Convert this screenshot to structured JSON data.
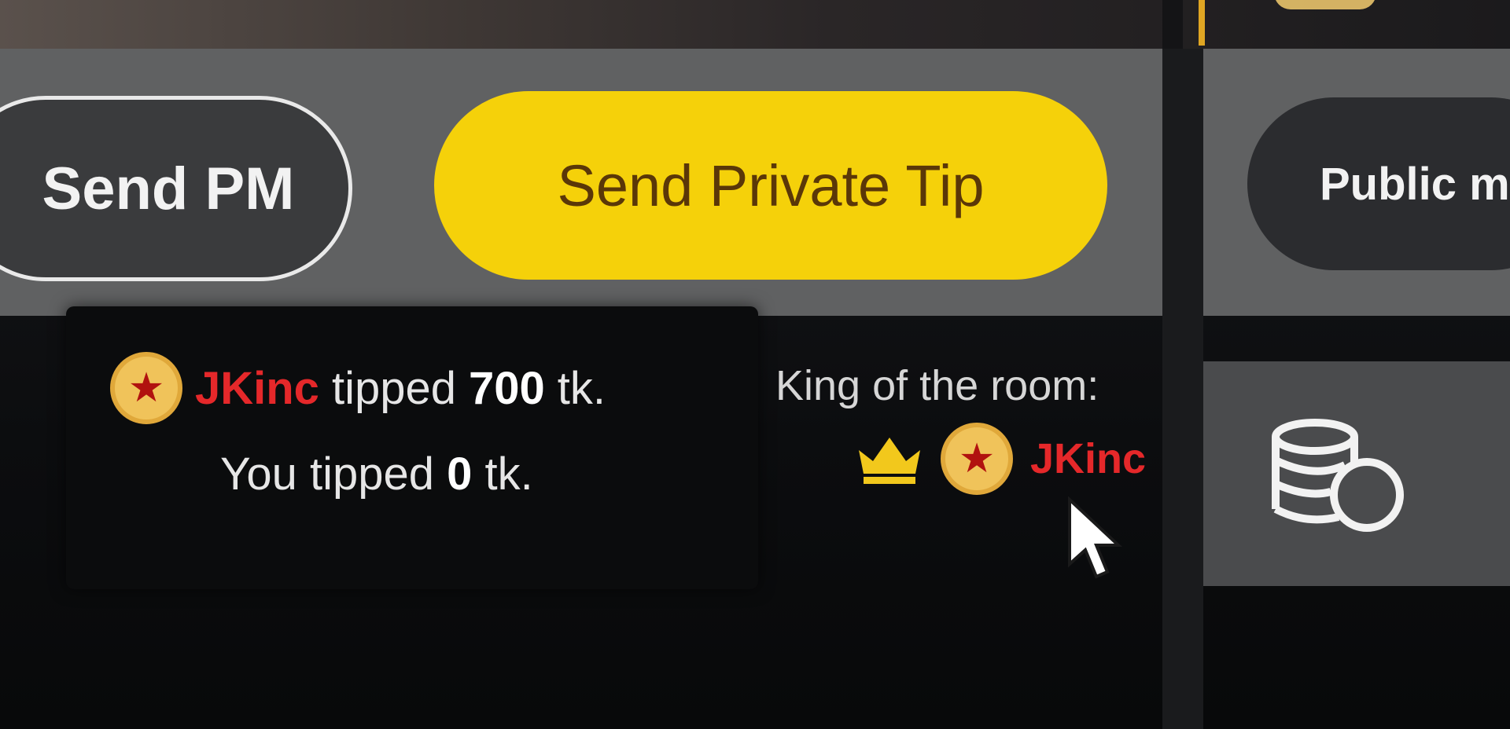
{
  "buttons": {
    "send_pm": "Send PM",
    "send_private_tip": "Send Private Tip",
    "public_message": "Public m"
  },
  "tip_notice": {
    "tipper_name": "JKinc",
    "tipped_word": "tipped",
    "tipped_amount": "700",
    "unit": "tk.",
    "you_prefix": "You tipped",
    "you_amount": "0",
    "you_unit": "tk."
  },
  "king": {
    "title": "King of the room:",
    "name": "JKinc"
  },
  "icons": {
    "badge": "star-badge-icon",
    "crown": "crown-icon",
    "coins": "coins-icon",
    "cursor": "mouse-cursor"
  },
  "colors": {
    "tip_button": "#f5d10a",
    "username": "#e5282a",
    "badge_gold": "#f0c35a"
  }
}
